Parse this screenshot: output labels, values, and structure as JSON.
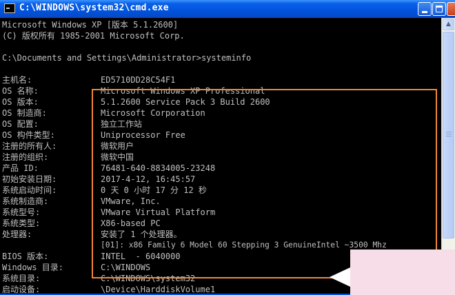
{
  "window": {
    "title": "C:\\WINDOWS\\system32\\cmd.exe",
    "min_label": "",
    "max_label": "",
    "close_label": "X"
  },
  "console": {
    "header_lines": [
      "Microsoft Windows XP [版本 5.1.2600]",
      "(C) 版权所有 1985-2001 Microsoft Corp.",
      "",
      "C:\\Documents and Settings\\Administrator>systeminfo"
    ],
    "rows": [
      {
        "label": "主机名:",
        "value": "ED5710DD28C54F1"
      },
      {
        "label": "OS 名称:",
        "value": "Microsoft Windows XP Professional"
      },
      {
        "label": "OS 版本:",
        "value": "5.1.2600 Service Pack 3 Build 2600"
      },
      {
        "label": "OS 制造商:",
        "value": "Microsoft Corporation"
      },
      {
        "label": "OS 配置:",
        "value": "独立工作站"
      },
      {
        "label": "OS 构件类型:",
        "value": "Uniprocessor Free"
      },
      {
        "label": "注册的所有人:",
        "value": "微软用户"
      },
      {
        "label": "注册的组织:",
        "value": "微软中国"
      },
      {
        "label": "产品 ID:",
        "value": "76481-640-8834005-23248"
      },
      {
        "label": "初始安装日期:",
        "value": "2017-4-12, 16:45:57"
      },
      {
        "label": "系统启动时间:",
        "value": "0 天 0 小时 17 分 12 秒"
      },
      {
        "label": "系统制造商:",
        "value": "VMware, Inc."
      },
      {
        "label": "系统型号:",
        "value": "VMware Virtual Platform"
      },
      {
        "label": "系统类型:",
        "value": "X86-based PC"
      },
      {
        "label": "处理器:",
        "value": "安装了 1 个处理器。"
      },
      {
        "label": "",
        "value": "[01]: x86 Family 6 Model 60 Stepping 3 GenuineIntel ~3500 Mhz"
      },
      {
        "label": "BIOS 版本:",
        "value": "INTEL  - 6040000"
      },
      {
        "label": "Windows 目录:",
        "value": "C:\\WINDOWS"
      },
      {
        "label": "系统目录:",
        "value": "C:\\WINDOWS\\system32"
      },
      {
        "label": "启动设备:",
        "value": "\\Device\\HarddiskVolume1"
      }
    ]
  },
  "scrollbar": {
    "up_arrow": "▲"
  },
  "colors": {
    "console_bg": "#000000",
    "console_text": "#c0c0c0",
    "highlight_border": "#f08a3c",
    "titlebar": "#0a5fe8",
    "watermark": "#f6dde8"
  }
}
